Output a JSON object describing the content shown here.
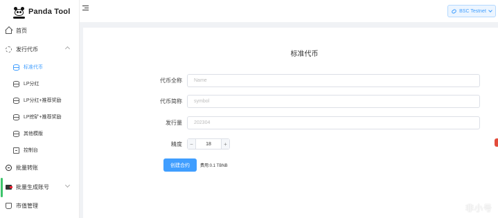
{
  "app": {
    "name": "Panda Tool"
  },
  "header": {
    "network": "BSC Testnet"
  },
  "sidebar": {
    "items": [
      {
        "label": "首页",
        "icon": "home-icon"
      },
      {
        "label": "发行代币",
        "icon": "issue-icon",
        "expanded": true
      },
      {
        "label": "标准代币",
        "icon": "database-icon",
        "active": true
      },
      {
        "label": "LP分红",
        "icon": "database-icon"
      },
      {
        "label": "LP分红+推荐奖励",
        "icon": "database-icon"
      },
      {
        "label": "LP挖矿+推荐奖励",
        "icon": "database-icon"
      },
      {
        "label": "其他模版",
        "icon": "database-icon"
      },
      {
        "label": "控制台",
        "icon": "console-icon"
      },
      {
        "label": "批量转账",
        "icon": "transfer-icon"
      },
      {
        "label": "批量生成账号",
        "icon": "wallet-icon"
      },
      {
        "label": "市值管理",
        "icon": "market-icon"
      }
    ]
  },
  "form": {
    "title": "标准代币",
    "name_label": "代币全称",
    "name_placeholder": "Name",
    "symbol_label": "代币简称",
    "symbol_placeholder": "symbol",
    "supply_label": "发行量",
    "supply_placeholder": "202304",
    "decimals_label": "精度",
    "decimals_value": "18",
    "decimals_minus": "−",
    "decimals_plus": "+",
    "create_button": "创建合约",
    "fee_text": "费用:0.1 TBNB"
  },
  "watermark": "非小号",
  "colors": {
    "primary": "#409eff",
    "background": "#f0f2f5",
    "badge": "#e24c3b"
  }
}
